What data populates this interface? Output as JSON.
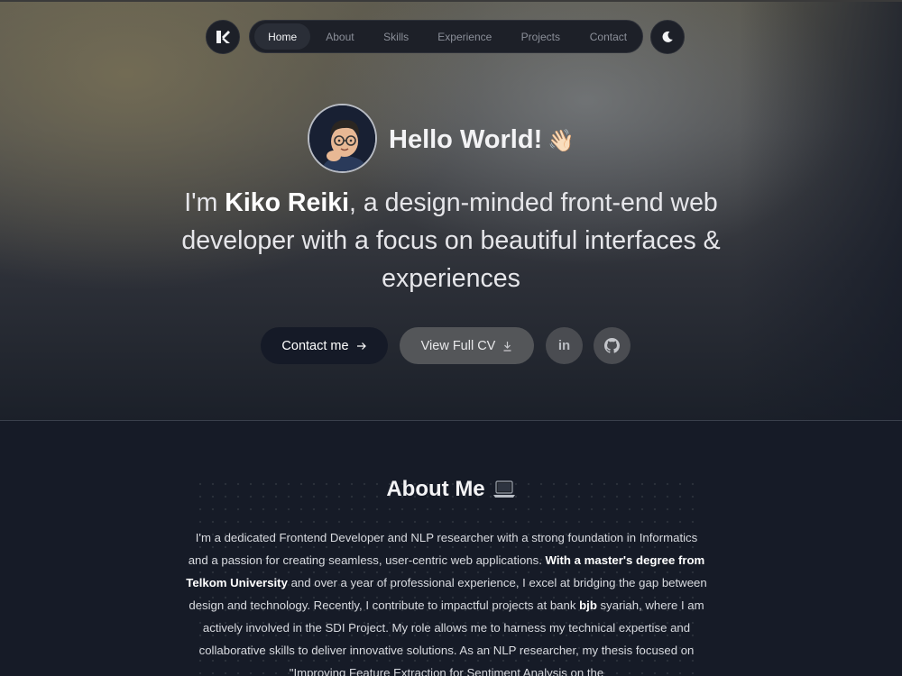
{
  "nav": {
    "logo_icon": "kr-logo-icon",
    "items": [
      {
        "label": "Home",
        "active": true
      },
      {
        "label": "About",
        "active": false
      },
      {
        "label": "Skills",
        "active": false
      },
      {
        "label": "Experience",
        "active": false
      },
      {
        "label": "Projects",
        "active": false
      },
      {
        "label": "Contact",
        "active": false
      }
    ],
    "theme_icon": "moon-icon"
  },
  "hero": {
    "greeting": "Hello World!",
    "wave_emoji": "👋🏻",
    "intro_prefix": "I'm ",
    "name": "Kiko Reiki",
    "intro_suffix": ", a design-minded front-end web developer with a focus on beautiful interfaces & experiences",
    "contact_label": "Contact me",
    "contact_icon": "arrow-right-icon",
    "cv_label": "View Full CV",
    "cv_icon": "download-icon",
    "linkedin_label": "in",
    "github_icon": "github-icon"
  },
  "about": {
    "title": "About Me",
    "title_emoji": "laptop-icon",
    "p1": "I'm a dedicated Frontend Developer and NLP researcher with a strong foundation in Informatics and a passion for creating seamless, user-centric web applications. ",
    "b1": "With a master's degree from Telkom University",
    "p2": " and over a year of professional experience, I excel at bridging the gap between design and technology. Recently, I contribute to impactful projects at bank ",
    "b2": "bjb",
    "p3": " syariah, where I am actively involved in the SDI Project. My role allows me to harness my technical expertise and collaborative skills to deliver innovative solutions. As an NLP researcher, my thesis focused on \"Improving Feature Extraction for Sentiment Analysis on the"
  },
  "colors": {
    "background": "#161b27",
    "nav_bg": "#1d2028",
    "contact_button": "#151a27",
    "cv_button": "#545659"
  }
}
